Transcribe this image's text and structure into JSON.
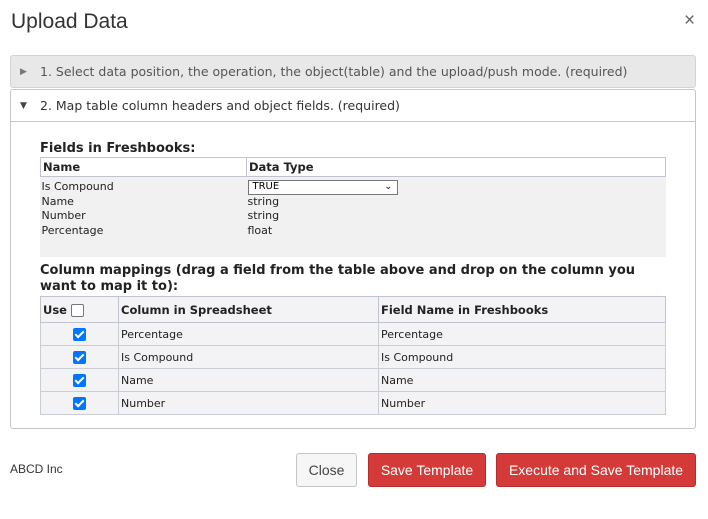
{
  "dialog": {
    "title": "Upload Data",
    "close_glyph": "×"
  },
  "step1": {
    "label": "1. Select data position, the operation, the object(table) and the upload/push mode. (required)"
  },
  "step2": {
    "label": "2. Map table column headers and object fields. (required)"
  },
  "fields": {
    "title": "Fields in Freshbooks:",
    "headers": [
      "Name",
      "Data Type"
    ],
    "rows": [
      {
        "name": "Is Compound",
        "type": "TRUE",
        "is_dropdown": true
      },
      {
        "name": "Name",
        "type": "string"
      },
      {
        "name": "Number",
        "type": "string"
      },
      {
        "name": "Percentage",
        "type": "float"
      }
    ]
  },
  "mappings": {
    "title_line1": "Column mappings (drag a field from the table above and drop on the column you",
    "title_line2": "want to map it to):",
    "headers": {
      "use": "Use",
      "column": "Column in Spreadsheet",
      "field": "Field Name in Freshbooks"
    },
    "header_checked": false,
    "rows": [
      {
        "checked": true,
        "column": "Percentage",
        "field": "Percentage"
      },
      {
        "checked": true,
        "column": "Is Compound",
        "field": "Is Compound"
      },
      {
        "checked": true,
        "column": "Name",
        "field": "Name"
      },
      {
        "checked": true,
        "column": "Number",
        "field": "Number"
      }
    ]
  },
  "footer": {
    "company": "ABCD Inc",
    "close_label": "Close",
    "save_label": "Save Template",
    "execute_label": "Execute and Save Template"
  },
  "icons": {
    "collapsed": "triangle-right-icon",
    "expanded": "triangle-down-icon",
    "close": "close-icon",
    "dropdown": "chevron-down-icon"
  },
  "colors": {
    "primary_button": "#d43a38",
    "checkbox": "#0075ff"
  }
}
